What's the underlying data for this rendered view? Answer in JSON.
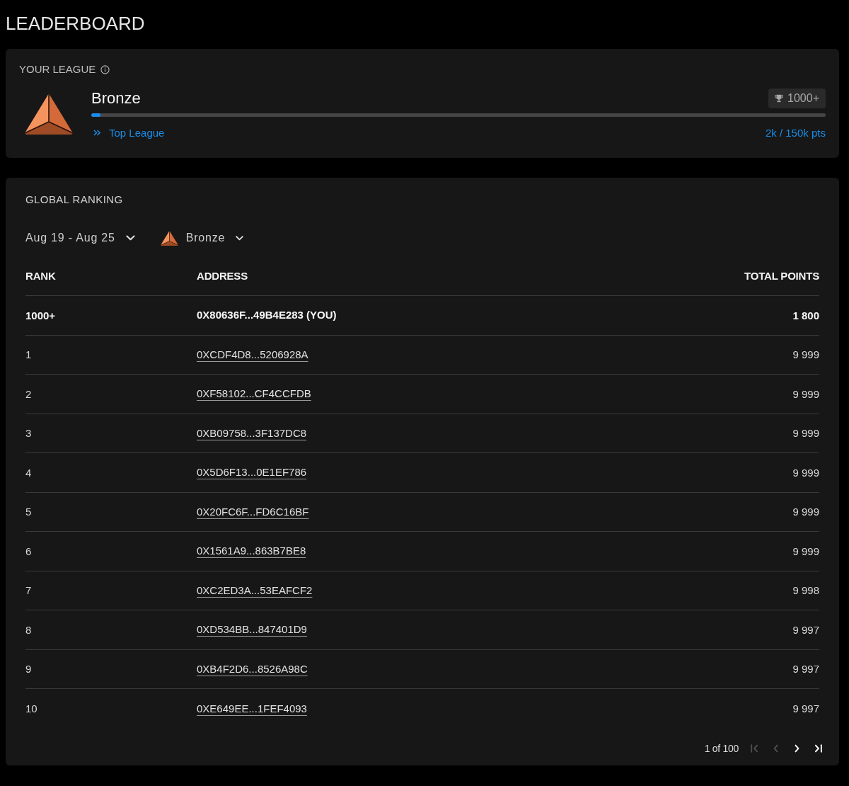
{
  "page": {
    "title": "LEADERBOARD"
  },
  "league": {
    "heading": "YOUR LEAGUE",
    "name": "Bronze",
    "rank_badge": "1000+",
    "level": 0.013,
    "link": "Top League",
    "points": "2k / 150k pts"
  },
  "ranking": {
    "heading": "GLOBAL RANKING",
    "filters": [
      {
        "kind": "date",
        "label": "Aug 19 - Aug 25"
      },
      {
        "kind": "league",
        "label": "Bronze"
      }
    ],
    "table": {
      "columns": [
        "RANK",
        "ADDRESS",
        "TOTAL POINTS"
      ],
      "rows": [
        {
          "rank": "1000+",
          "address": "0X80636F...49B4E283 (YOU)",
          "points": "1 800",
          "current_user": true
        },
        {
          "rank": "1",
          "address": "0XCDF4D8...5206928A",
          "points": "9 999",
          "current_user": false
        },
        {
          "rank": "2",
          "address": "0XF58102...CF4CCFDB",
          "points": "9 999",
          "current_user": false
        },
        {
          "rank": "3",
          "address": "0XB09758...3F137DC8",
          "points": "9 999",
          "current_user": false
        },
        {
          "rank": "4",
          "address": "0X5D6F13...0E1EF786",
          "points": "9 999",
          "current_user": false
        },
        {
          "rank": "5",
          "address": "0X20FC6F...FD6C16BF",
          "points": "9 999",
          "current_user": false
        },
        {
          "rank": "6",
          "address": "0X1561A9...863B7BE8",
          "points": "9 999",
          "current_user": false
        },
        {
          "rank": "7",
          "address": "0XC2ED3A...53EAFCF2",
          "points": "9 998",
          "current_user": false
        },
        {
          "rank": "8",
          "address": "0XD534BB...847401D9",
          "points": "9 997",
          "current_user": false
        },
        {
          "rank": "9",
          "address": "0XB4F2D6...8526A98C",
          "points": "9 997",
          "current_user": false
        },
        {
          "rank": "10",
          "address": "0XE649EE...1FEF4093",
          "points": "9 997",
          "current_user": false
        }
      ]
    },
    "pagination": {
      "label": "1 of 100",
      "buttons": [
        {
          "kind": "first",
          "disabled": true
        },
        {
          "kind": "prev",
          "disabled": true
        },
        {
          "kind": "next",
          "disabled": false
        },
        {
          "kind": "last",
          "disabled": false
        }
      ]
    }
  }
}
